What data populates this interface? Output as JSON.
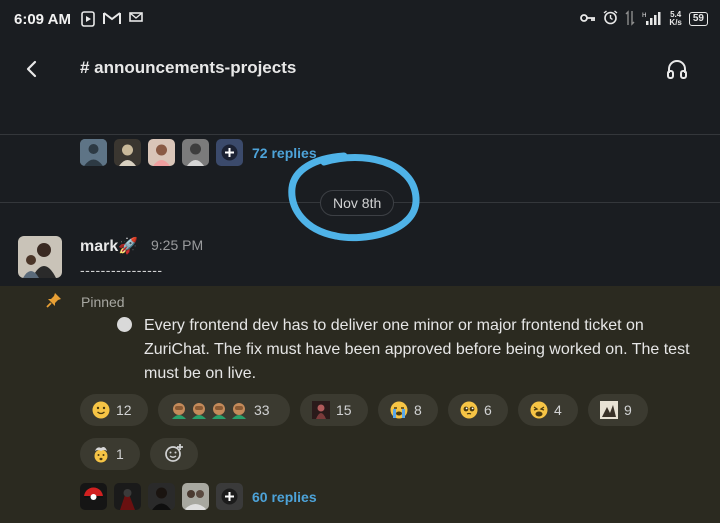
{
  "status_bar": {
    "time": "6:09 AM",
    "network_speed_top": "5.4",
    "network_speed_bottom": "K/s",
    "battery": "59"
  },
  "header": {
    "channel_name": "# announcements-projects"
  },
  "thread_top": {
    "replies_label": "72 replies"
  },
  "date_divider": {
    "label": "Nov 8th"
  },
  "message": {
    "author": "mark",
    "author_emoji": "🚀",
    "time": "9:25 PM",
    "body_line": "----------------"
  },
  "pinned": {
    "label": "Pinned",
    "text": "Every frontend dev has to deliver one minor or major frontend ticket on ZuriChat. The fix must have been approved before being worked on. The test must be on live."
  },
  "reactions": [
    {
      "emoji": "slightly-smiling-face",
      "count": "12"
    },
    {
      "emoji": "facepalm-people",
      "count": "33"
    },
    {
      "emoji": "custom-image",
      "count": "15"
    },
    {
      "emoji": "loudly-crying-face",
      "count": "8"
    },
    {
      "emoji": "pleading-face",
      "count": "6"
    },
    {
      "emoji": "tired-face",
      "count": "4"
    },
    {
      "emoji": "custom-image-2",
      "count": "9"
    },
    {
      "emoji": "exploding-head",
      "count": "1"
    }
  ],
  "thread_bottom": {
    "replies_label": "60 replies"
  },
  "colors": {
    "background": "#1a1d21",
    "pinned_background": "#2b2a20",
    "link": "#4da3d9",
    "highlight_annotation": "#4fb3e8"
  }
}
